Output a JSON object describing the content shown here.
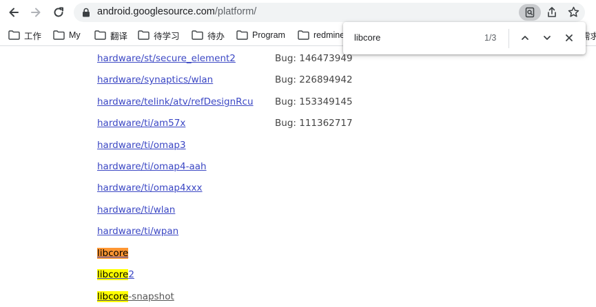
{
  "toolbar": {
    "url_host": "android.googlesource.com",
    "url_path": "/platform/"
  },
  "bookmarks": [
    {
      "label": "工作"
    },
    {
      "label": "My"
    },
    {
      "label": "翻译"
    },
    {
      "label": "待学习"
    },
    {
      "label": "待办"
    },
    {
      "label": "Program"
    },
    {
      "label": "redmine"
    },
    {
      "label": "需求"
    }
  ],
  "find": {
    "query": "libcore",
    "count": "1/3"
  },
  "repos": [
    {
      "name": "hardware/st/secure_element2",
      "desc": "Bug: 146473949"
    },
    {
      "name": "hardware/synaptics/wlan",
      "desc": "Bug: 226894942"
    },
    {
      "name": "hardware/telink/atv/refDesignRcu",
      "desc": "Bug: 153349145"
    },
    {
      "name": "hardware/ti/am57x",
      "desc": "Bug: 111362717"
    },
    {
      "name": "hardware/ti/omap3",
      "desc": ""
    },
    {
      "name": "hardware/ti/omap4-aah",
      "desc": ""
    },
    {
      "name": "hardware/ti/omap4xxx",
      "desc": ""
    },
    {
      "name": "hardware/ti/wlan",
      "desc": ""
    },
    {
      "name": "hardware/ti/wpan",
      "desc": ""
    }
  ],
  "libcore_rows": [
    {
      "match": "libcore",
      "rest": ""
    },
    {
      "match": "libcore",
      "rest": "2"
    },
    {
      "match": "libcore",
      "rest": "-snapshot"
    }
  ],
  "colors": {
    "link": "#3b47c4",
    "current_match": "#ff9632",
    "other_match": "#ffff00"
  }
}
